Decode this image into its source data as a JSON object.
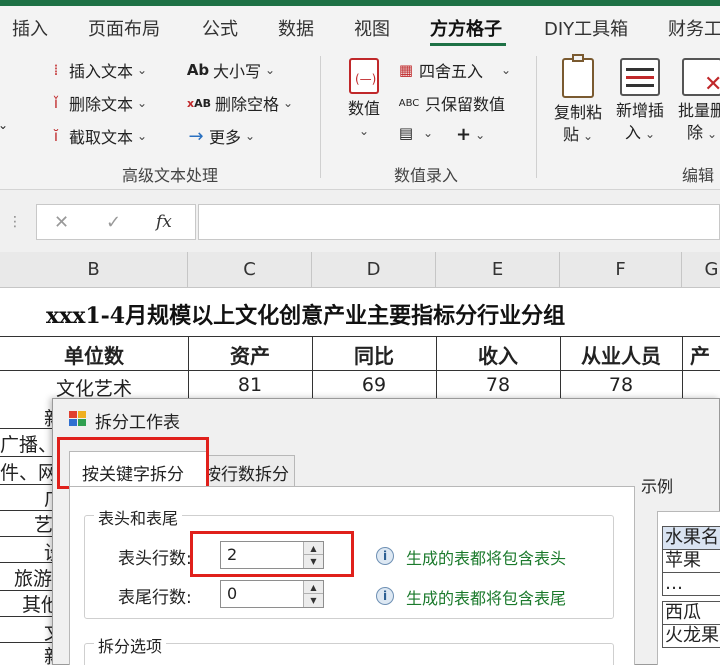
{
  "ribbon_tabs": [
    "插入",
    "页面布局",
    "公式",
    "数据",
    "视图",
    "方方格子",
    "DIY工具箱",
    "财务工"
  ],
  "active_tab": "方方格子",
  "ribbon": {
    "text_group": {
      "insert_text": "插入文本",
      "delete_text": "删除文本",
      "cut_text": "截取文本",
      "case": "大小写",
      "case_icon": "Ab",
      "remove_space": "删除空格",
      "remove_space_icon": "AB",
      "more": "更多",
      "label": "高级文本处理"
    },
    "number_group": {
      "value": "数值",
      "round": "四舍五入",
      "keep_number": "只保留数值",
      "keep_number_icon": "ABC",
      "plus": "+",
      "label": "数值录入"
    },
    "edit_group": {
      "copy_paste_l1": "复制粘",
      "copy_paste_l2": "贴",
      "add_insert_l1": "新增插",
      "add_insert_l2": "入",
      "batch_delete_l1": "批量删",
      "batch_delete_l2": "除",
      "label": "编辑"
    }
  },
  "formula_bar": {
    "cancel": "✕",
    "confirm": "✓",
    "fx": "fx",
    "value": ""
  },
  "columns": [
    "B",
    "C",
    "D",
    "E",
    "F",
    "G"
  ],
  "sheet": {
    "title": "xxx1-4月规模以上文化创意产业主要指标分行业分组",
    "headers": [
      "单位数",
      "资产",
      "同比",
      "收入",
      "从业人员",
      "产"
    ],
    "row1": [
      "文化艺术",
      "81",
      "69",
      "78",
      "78"
    ],
    "left_labels": [
      "新",
      "广播、",
      "件、网",
      "广",
      "艺",
      "设",
      "旅游",
      "其他",
      "文",
      "新"
    ]
  },
  "dialog": {
    "title": "拆分工作表",
    "tab_keyword": "按关键字拆分",
    "tab_rows": "按行数拆分",
    "group_header_footer": "表头和表尾",
    "header_rows_label": "表头行数:",
    "header_rows_value": "2",
    "footer_rows_label": "表尾行数:",
    "footer_rows_value": "0",
    "header_tip": "生成的表都将包含表头",
    "footer_tip": "生成的表都将包含表尾",
    "group_split_options": "拆分选项",
    "example_label": "示例",
    "example_rows": [
      "水果名",
      "苹果",
      "…",
      "西瓜",
      "火龙果"
    ]
  },
  "colors": {
    "accent": "#1e7145",
    "highlight": "#e0201b",
    "tip": "#1b7a2c"
  }
}
